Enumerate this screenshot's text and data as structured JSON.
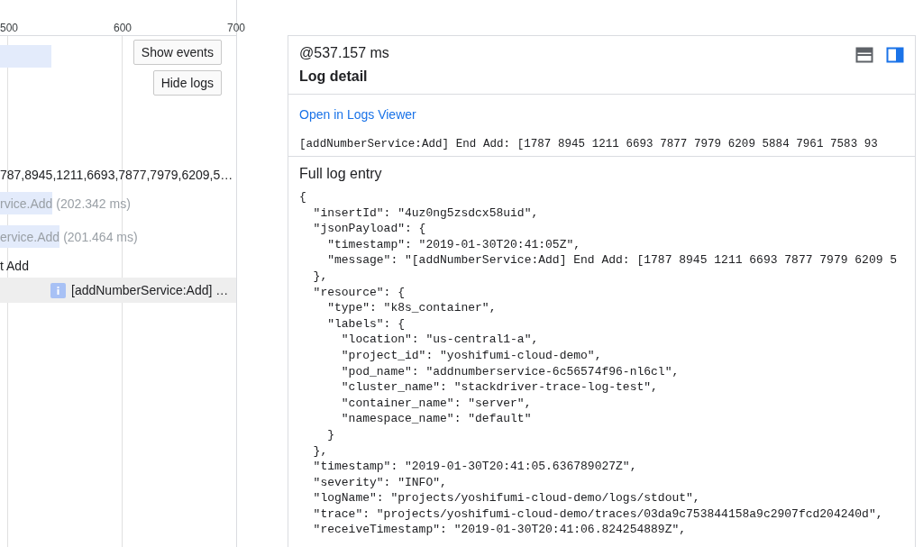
{
  "timeline": {
    "axis_labels": [
      "500",
      "600",
      "700"
    ],
    "buttons": [
      {
        "label": "Show events"
      },
      {
        "label": "Hide logs"
      }
    ],
    "rows": [
      {
        "kind": "bar"
      },
      {
        "kind": "text",
        "text": "787,8945,1211,6693,7877,7979,6209,5…"
      },
      {
        "kind": "span",
        "text": "rvice.Add",
        "duration": "(202.342 ms)"
      },
      {
        "kind": "span",
        "text": "ervice.Add",
        "duration": "(201.464 ms)"
      },
      {
        "kind": "text",
        "text": "t Add"
      },
      {
        "kind": "log",
        "text": "[addNumberService:Add] …",
        "selected": true
      }
    ]
  },
  "log_panel": {
    "time": "@537.157 ms",
    "title": "Log detail",
    "layout_buttons": [
      {
        "kind": "stacked",
        "selected": false
      },
      {
        "kind": "side",
        "selected": true
      }
    ],
    "link": "Open in Logs Viewer",
    "message": "[addNumberService:Add] End Add: [1787 8945 1211 6693 7877 7979 6209 5884 7961 7583 93",
    "full_entry_title": "Full log entry",
    "code_lines": [
      "{",
      "  \"insertId\": \"4uz0ng5zsdcx58uid\",",
      "  \"jsonPayload\": {",
      "    \"timestamp\": \"2019-01-30T20:41:05Z\",",
      "    \"message\": \"[addNumberService:Add] End Add: [1787 8945 1211 6693 7877 7979 6209 5",
      "  },",
      "  \"resource\": {",
      "    \"type\": \"k8s_container\",",
      "    \"labels\": {",
      "      \"location\": \"us-central1-a\",",
      "      \"project_id\": \"yoshifumi-cloud-demo\",",
      "      \"pod_name\": \"addnumberservice-6c56574f96-nl6cl\",",
      "      \"cluster_name\": \"stackdriver-trace-log-test\",",
      "      \"container_name\": \"server\",",
      "      \"namespace_name\": \"default\"",
      "    }",
      "  },",
      "  \"timestamp\": \"2019-01-30T20:41:05.636789027Z\",",
      "  \"severity\": \"INFO\",",
      "  \"logName\": \"projects/yoshifumi-cloud-demo/logs/stdout\",",
      "  \"trace\": \"projects/yoshifumi-cloud-demo/traces/03da9c753844158a9c2907fcd204240d\",",
      "  \"receiveTimestamp\": \"2019-01-30T20:41:06.824254889Z\","
    ]
  }
}
